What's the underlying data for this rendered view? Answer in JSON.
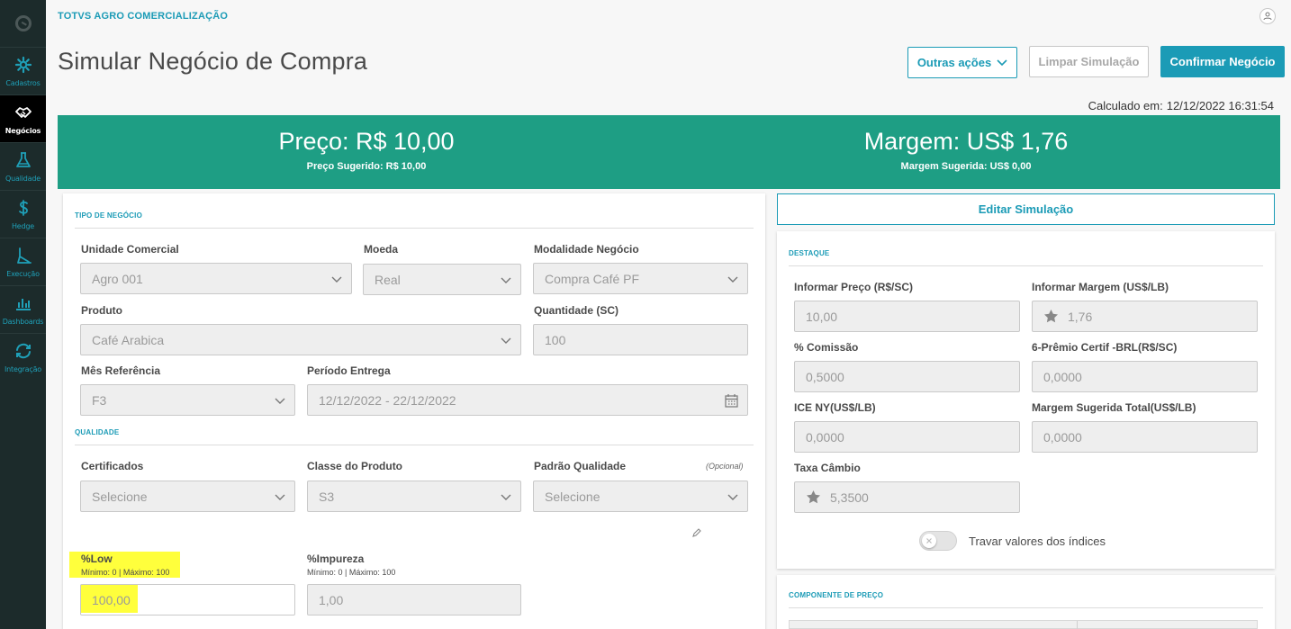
{
  "sidebar": {
    "items": [
      {
        "label": "Cadastros",
        "icon": "gear-icon"
      },
      {
        "label": "Negócios",
        "icon": "handshake-icon"
      },
      {
        "label": "Qualidade",
        "icon": "flask-icon"
      },
      {
        "label": "Hedge",
        "icon": "dollar-icon"
      },
      {
        "label": "Execução",
        "icon": "execution-icon"
      },
      {
        "label": "Dashboards",
        "icon": "bar-chart-icon"
      },
      {
        "label": "Integração",
        "icon": "sync-icon"
      }
    ]
  },
  "header": {
    "company": "TOTVS AGRO COMERCIALIZAÇÃO",
    "title": "Simular Negócio de Compra",
    "other_actions": "Outras ações",
    "clear": "Limpar Simulação",
    "confirm": "Confirmar Negócio",
    "calculated_label": "Calculado em:",
    "calculated_at": "12/12/2022 16:31:54"
  },
  "banner": {
    "price": "Preço: R$ 10,00",
    "price_suggested": "Preço Sugerido: R$ 10,00",
    "margin": "Margem: US$ 1,76",
    "margin_suggested": "Margem Sugerida: US$ 0,00"
  },
  "left": {
    "section_tipo": "TIPO DE NEGÓCIO",
    "unidade_label": "Unidade Comercial",
    "unidade_value": "Agro 001",
    "moeda_label": "Moeda",
    "moeda_value": "Real",
    "modalidade_label": "Modalidade Negócio",
    "modalidade_value": "Compra Café PF",
    "produto_label": "Produto",
    "produto_value": "Café Arabica",
    "quantidade_label": "Quantidade (SC)",
    "quantidade_value": "100",
    "mes_label": "Mês Referência",
    "mes_value": "F3",
    "periodo_label": "Período Entrega",
    "periodo_value": "12/12/2022 - 22/12/2022",
    "section_qualidade": "QUALIDADE",
    "certificados_label": "Certificados",
    "certificados_value": "Selecione",
    "classe_label": "Classe do Produto",
    "classe_value": "S3",
    "padrao_label": "Padrão Qualidade",
    "padrao_optional": "(Opcional)",
    "padrao_value": "Selecione",
    "low_label": "%Low",
    "low_hint": "Mínimo: 0 | Máximo: 100",
    "low_value": "100,00",
    "impureza_label": "%Impureza",
    "impureza_hint": "Mínimo: 0 | Máximo: 100",
    "impureza_value": "1,00"
  },
  "right": {
    "edit_button": "Editar Simulação",
    "section_destaque": "DESTAQUE",
    "preco_label": "Informar Preço (R$/SC)",
    "preco_value": "10,00",
    "margem_label": "Informar Margem (US$/LB)",
    "margem_value": "1,76",
    "comissao_label": "% Comissão",
    "comissao_value": "0,5000",
    "premio_label": "6-Prêmio Certif -BRL(R$/SC)",
    "premio_value": "0,0000",
    "ice_label": "ICE NY(US$/LB)",
    "ice_value": "0,0000",
    "margem_total_label": "Margem Sugerida Total(US$/LB)",
    "margem_total_value": "0,0000",
    "cambio_label": "Taxa Câmbio",
    "cambio_value": "5,3500",
    "toggle_label": "Travar valores dos índices",
    "section_componente": "COMPONENTE DE PREÇO"
  },
  "colors": {
    "accent": "#1b9bb6",
    "banner": "#1e9e84",
    "sidebar": "#1c2b2b",
    "highlight": "#ffff3c"
  }
}
